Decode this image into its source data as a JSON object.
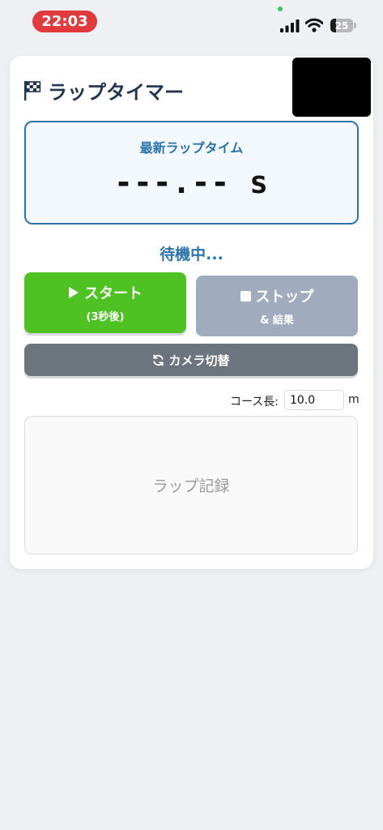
{
  "status_bar": {
    "time": "22:03",
    "battery": "25",
    "battery_fraction": 0.25,
    "icons": [
      "recording-dot",
      "cellular-signal-icon",
      "wifi-icon",
      "battery-icon"
    ]
  },
  "app": {
    "title": "ラップタイマー",
    "title_icon": "checkered-flag-icon"
  },
  "lap_display": {
    "label": "最新ラップタイム",
    "value": "---.-- s"
  },
  "status": "待機中...",
  "buttons": {
    "start_label": "スタート",
    "start_sub": "(3秒後)",
    "stop_label": "ストップ",
    "stop_sub": "& 結果",
    "camera_label": "カメラ切替"
  },
  "course": {
    "label": "コース長:",
    "value": "10.0",
    "unit": "m"
  },
  "lap_record": {
    "placeholder": "ラップ記録"
  },
  "colors": {
    "accent": "#2a73ad",
    "start": "#4fc223",
    "stop": "#a0acbd",
    "camera": "#6c757d",
    "time_badge": "#e03a3d"
  }
}
